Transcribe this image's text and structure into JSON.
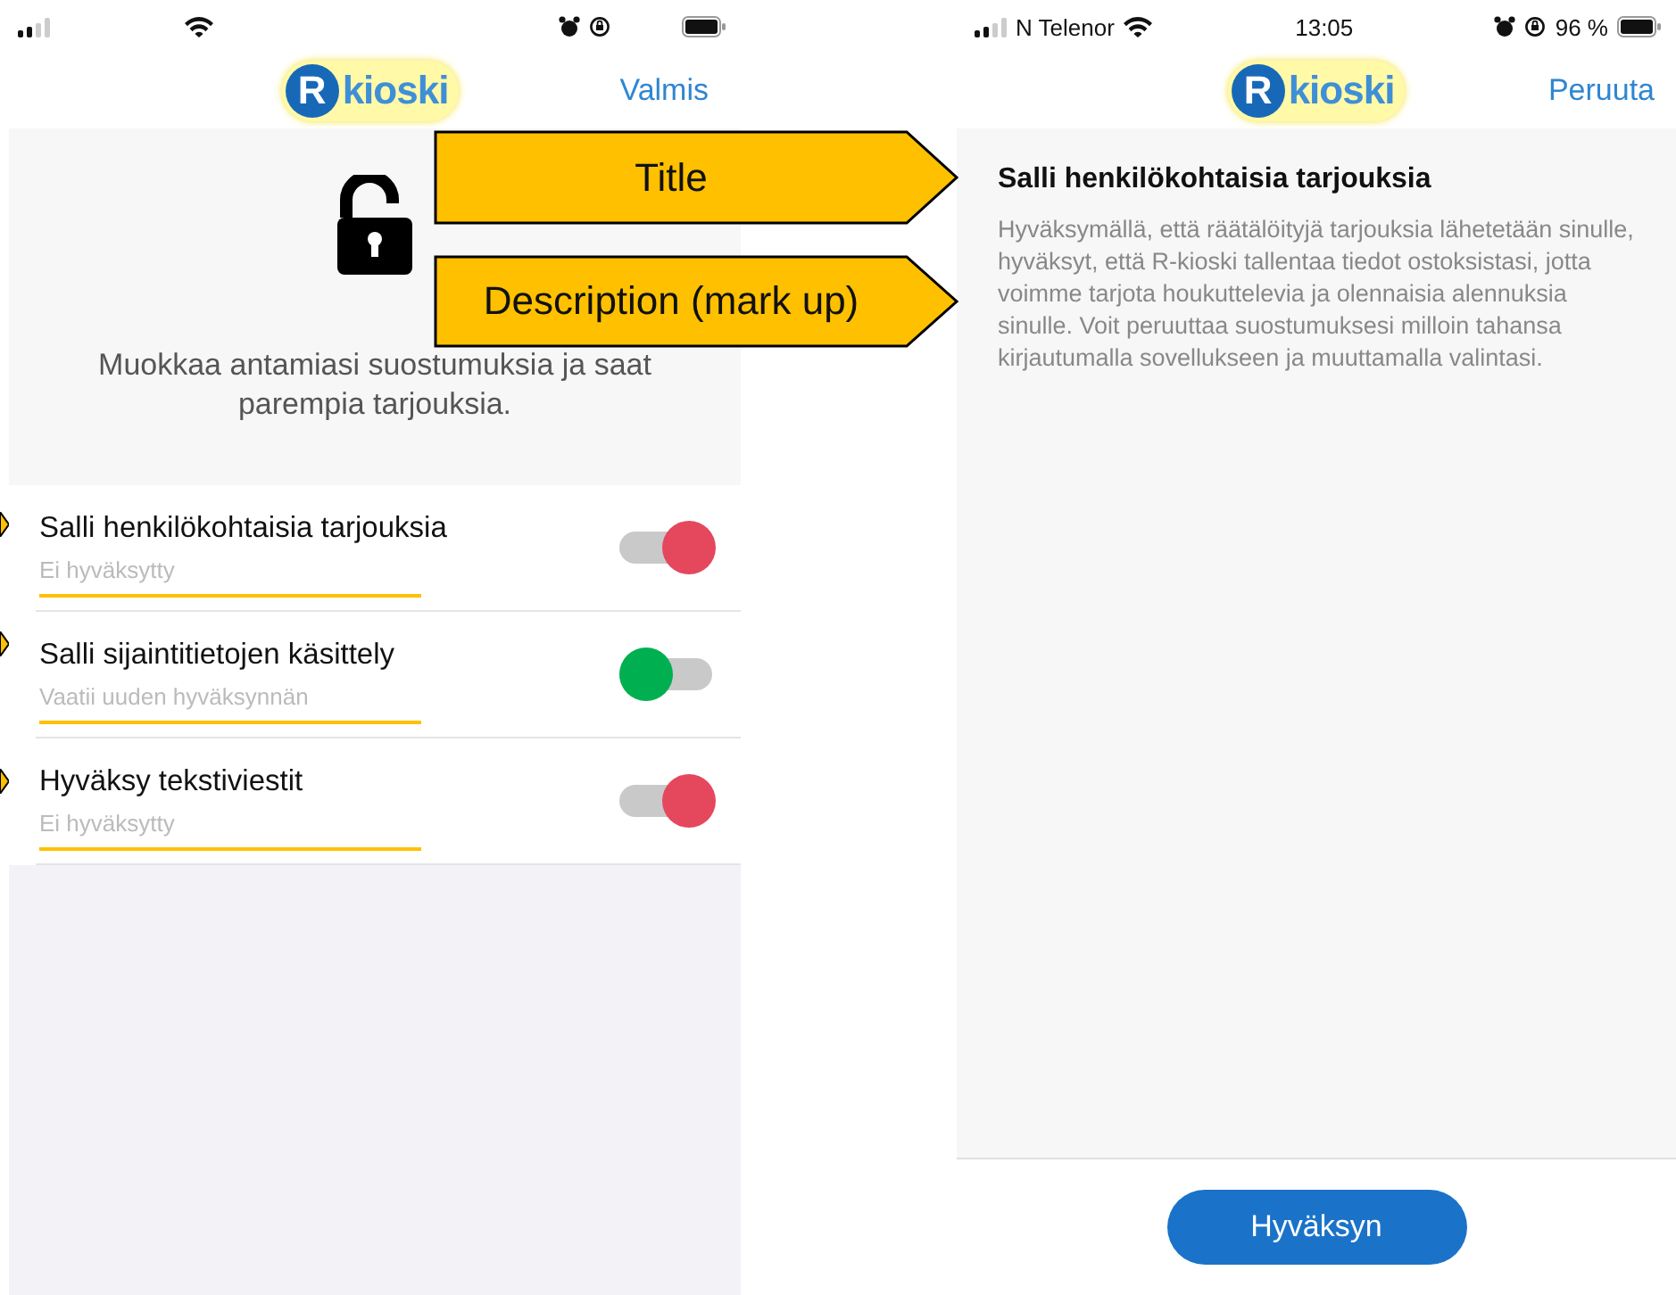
{
  "left_screen": {
    "logo": {
      "mark": "R",
      "name": "kioski"
    },
    "nav_action": "Valmis",
    "intro": "Muokkaa antamiasi suostumuksia ja saat parempia tarjouksia.",
    "consents": [
      {
        "title": "Salli henkilökohtaisia tarjouksia",
        "status": "Ei hyväksytty",
        "on": true,
        "color": "#e5475d"
      },
      {
        "title": "Salli sijaintitietojen käsittely",
        "status": "Vaatii uuden hyväksynnän",
        "on": false,
        "color": "#00b050"
      },
      {
        "title": "Hyväksy tekstiviestit",
        "status": "Ei hyväksytty",
        "on": true,
        "color": "#e5475d"
      }
    ]
  },
  "right_screen": {
    "status_bar": {
      "carrier": "N Telenor",
      "time": "13:05",
      "battery": "96 %"
    },
    "logo": {
      "mark": "R",
      "name": "kioski"
    },
    "nav_action": "Peruuta",
    "title": "Salli henkilökohtaisia tarjouksia",
    "description": "Hyväksymällä, että räätälöityjä tarjouksia lähetetään sinulle, hyväksyt, että R-kioski tallentaa tiedot ostoksistasi, jotta voimme tarjota houkuttelevia ja olennaisia alennuksia sinulle. Voit peruuttaa suostumuksesi milloin tahansa kirjautumalla sovellukseen ja muuttamalla valintasi.",
    "button": "Hyväksyn"
  },
  "annotations": [
    {
      "label": "Title"
    },
    {
      "label": "Description (mark up)"
    }
  ]
}
